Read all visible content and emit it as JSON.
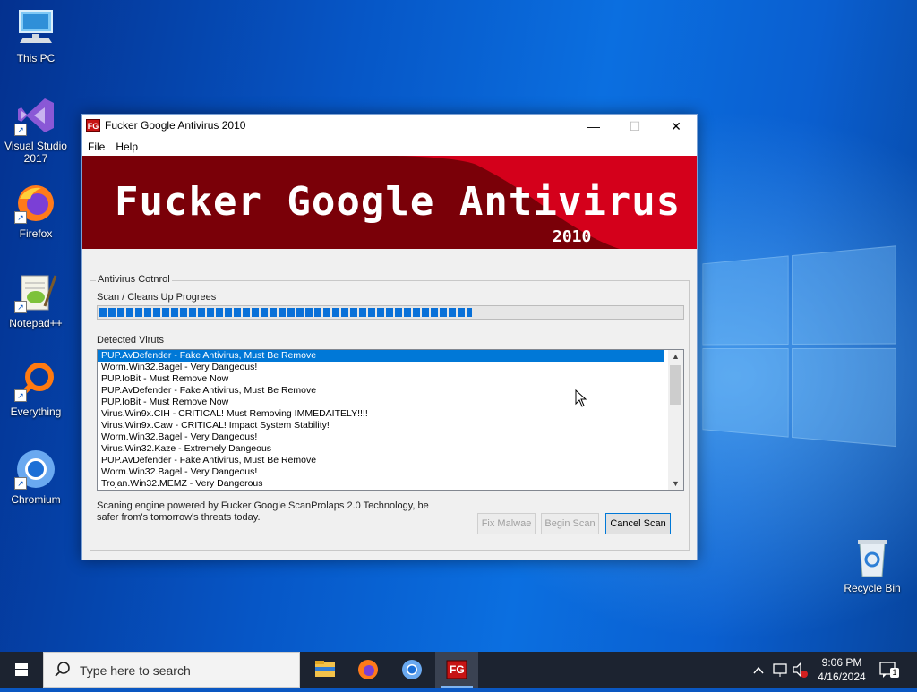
{
  "desktop": {
    "icons": [
      {
        "label": "This PC",
        "icon": "this-pc-icon"
      },
      {
        "label": "Visual Studio 2017",
        "icon": "visual-studio-icon"
      },
      {
        "label": "Firefox",
        "icon": "firefox-icon"
      },
      {
        "label": "Notepad++",
        "icon": "notepad-plus-plus-icon"
      },
      {
        "label": "Everything",
        "icon": "everything-search-icon"
      },
      {
        "label": "Chromium",
        "icon": "chromium-icon"
      },
      {
        "label": "Recycle Bin",
        "icon": "recycle-bin-icon"
      }
    ]
  },
  "window": {
    "title": "Fucker Google Antivirus 2010",
    "icon_text": "FG",
    "menu": [
      "File",
      "Help"
    ],
    "banner": {
      "title": "Fucker Google Antivirus",
      "year": "2010"
    },
    "group_label": "Antivirus Cotnrol",
    "progress_label": "Scan / Cleans Up Progrees",
    "progress_fraction": 0.64,
    "detected_label": "Detected Viruts",
    "detected": [
      "PUP.AvDefender - Fake Antivirus, Must Be Remove",
      "Worm.Win32.Bagel - Very Dangeous!",
      "PUP.IoBit - Must Remove Now",
      "PUP.AvDefender - Fake Antivirus, Must Be Remove",
      "PUP.IoBit - Must Remove Now",
      "Virus.Win9x.CIH - CRITICAL! Must Removing IMMEDAITELY!!!!",
      "Virus.Win9x.Caw - CRITICAL! Impact System Stability!",
      "Worm.Win32.Bagel - Very Dangeous!",
      "Virus.Win32.Kaze  - Extremely Dangeous",
      "PUP.AvDefender - Fake Antivirus, Must Be Remove",
      "Worm.Win32.Bagel - Very Dangeous!",
      "Trojan.Win32.MEMZ - Very Dangerous"
    ],
    "selected_index": 0,
    "footer_line1": "Scaning engine powered by Fucker Google ScanProlaps 2.0 Technology, be",
    "footer_line2": "safer from's tomorrow's threats today.",
    "buttons": {
      "fix": "Fix Malwae",
      "begin": "Begin Scan",
      "cancel": "Cancel Scan"
    }
  },
  "taskbar": {
    "search_placeholder": "Type here to search",
    "apps": [
      "file-explorer-icon",
      "firefox-icon",
      "chromium-icon",
      "fucker-google-antivirus-icon"
    ],
    "time": "9:06 PM",
    "date": "4/16/2024",
    "notification_count": "1"
  }
}
